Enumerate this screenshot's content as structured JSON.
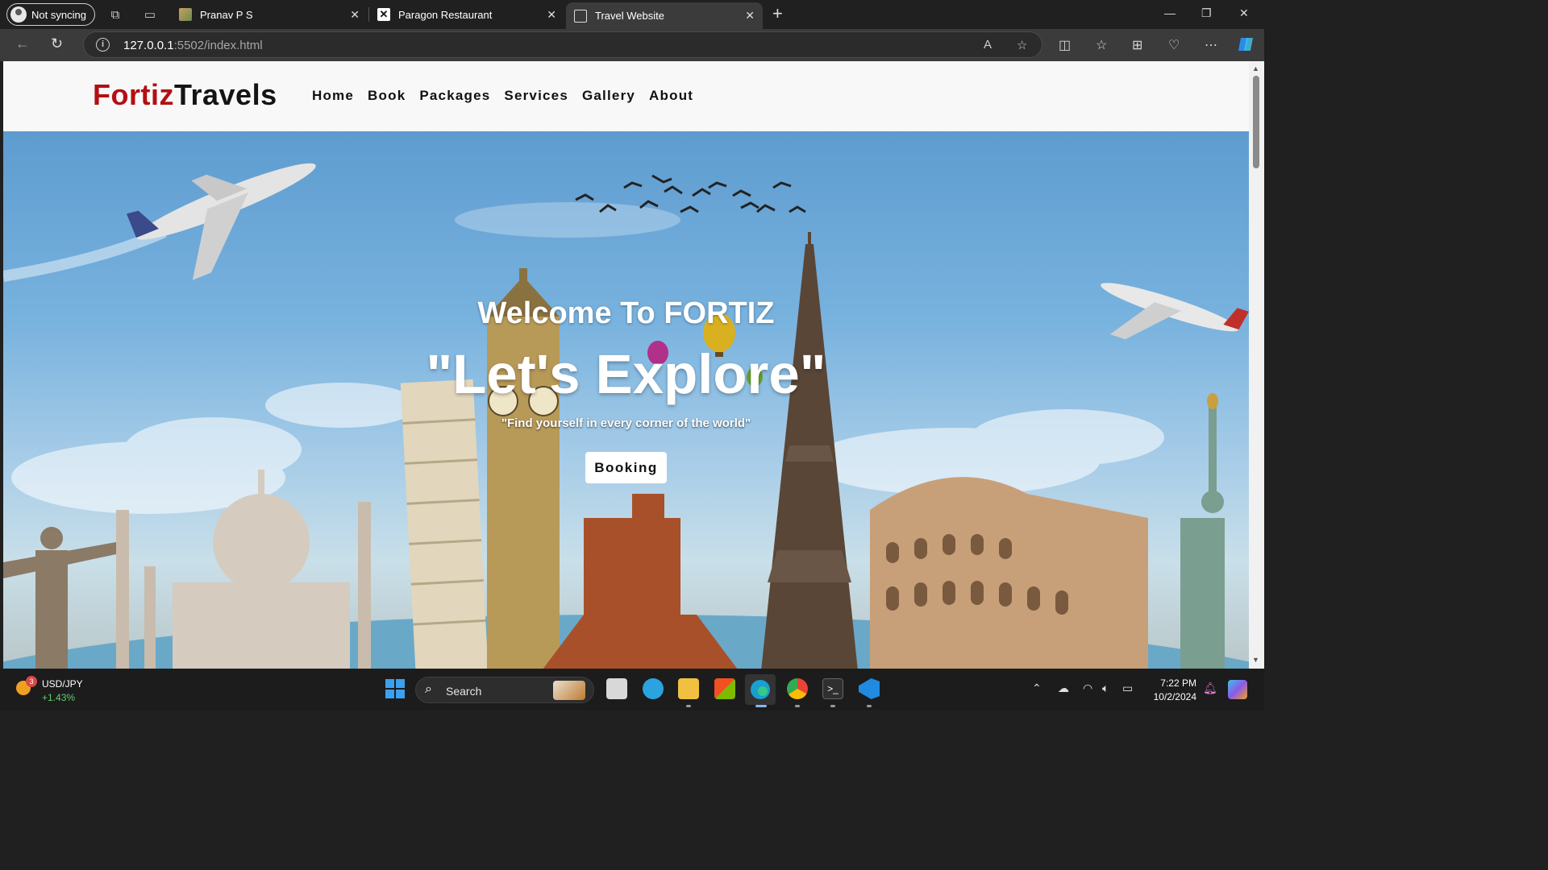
{
  "browser": {
    "profile_label": "Not syncing",
    "tabs": [
      {
        "title": "Pranav P S"
      },
      {
        "title": "Paragon Restaurant"
      },
      {
        "title": "Travel Website"
      }
    ],
    "url_host": "127.0.0.1",
    "url_path": ":5502/index.html"
  },
  "site": {
    "logo_part1": "Fortiz",
    "logo_part2": "Travels",
    "nav": [
      "Home",
      "Book",
      "Packages",
      "Services",
      "Gallery",
      "About"
    ],
    "hero": {
      "welcome": "Welcome To FORTIZ",
      "tagline": "\"Let's Explore\"",
      "subline": "\"Find yourself in every corner of the world\"",
      "button": "Booking"
    }
  },
  "taskbar": {
    "ticker_badge": "3",
    "ticker_symbol": "USD/JPY",
    "ticker_change": "+1.43%",
    "search_label": "Search",
    "time": "7:22 PM",
    "date": "10/2/2024"
  },
  "colors": {
    "logo_red": "#b30f14",
    "logo_dark": "#141414",
    "ticker_green": "#5fcf6a"
  }
}
